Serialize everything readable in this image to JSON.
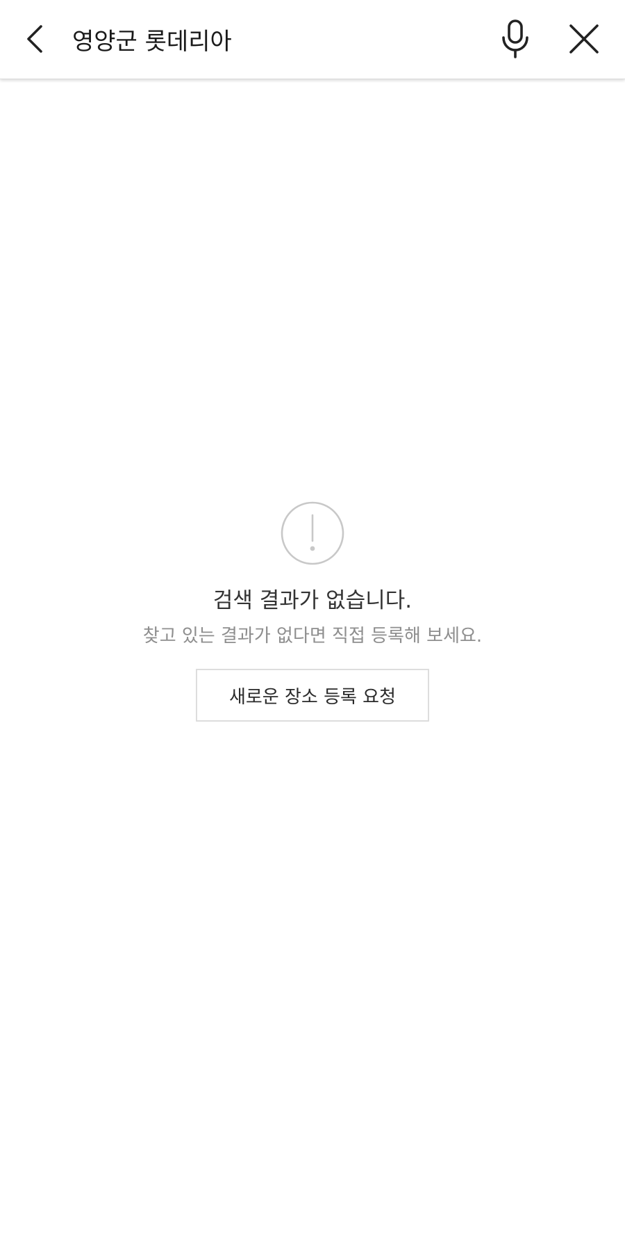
{
  "search": {
    "query": "영양군 롯데리아"
  },
  "icons": {
    "back": "chevron-left-icon",
    "mic": "microphone-icon",
    "close": "close-icon",
    "alert": "exclamation-circle-icon"
  },
  "empty_state": {
    "title": "검색 결과가 없습니다.",
    "subtitle": "찾고 있는 결과가 없다면 직접 등록해 보세요.",
    "request_button_label": "새로운 장소 등록 요청"
  },
  "colors": {
    "text_primary": "#1a1a1a",
    "text_secondary": "#8e8e8e",
    "icon_gray": "#c8c8c8",
    "button_border": "#dddddd"
  }
}
